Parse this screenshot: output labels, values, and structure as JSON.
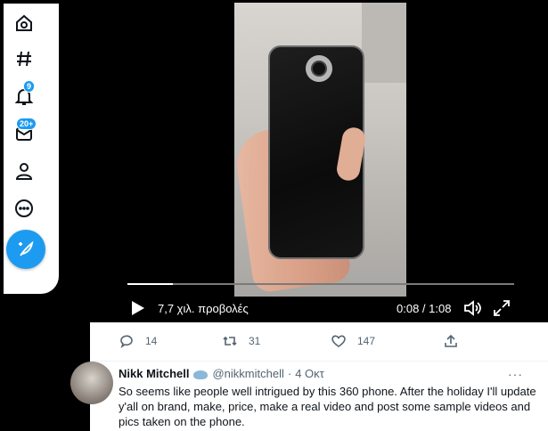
{
  "nav": {
    "items": [
      {
        "icon": "home-icon"
      },
      {
        "icon": "explore-hashtag-icon"
      },
      {
        "icon": "notifications-bell-icon",
        "badge": "9"
      },
      {
        "icon": "messages-envelope-icon",
        "badge": "20+"
      },
      {
        "icon": "profile-icon"
      },
      {
        "icon": "more-circle-icon"
      }
    ],
    "compose_icon": "compose-feather-icon",
    "accent": "#1d9bf0"
  },
  "video": {
    "views": "7,7 χιλ. προβολές",
    "time": "0:08 / 1:08",
    "progress": 0.118
  },
  "actions": {
    "replies": "14",
    "retweets": "31",
    "likes": "147"
  },
  "reply": {
    "name": "Nikk Mitchell",
    "handle": "@nikkmitchell",
    "separator": "·",
    "date": "4 Οκτ",
    "more": "···",
    "text": "So seems like people well intrigued by this 360 phone. After the holiday I'll update y'all on brand, make, price, make a real video and post some sample videos and pics taken on the phone."
  }
}
